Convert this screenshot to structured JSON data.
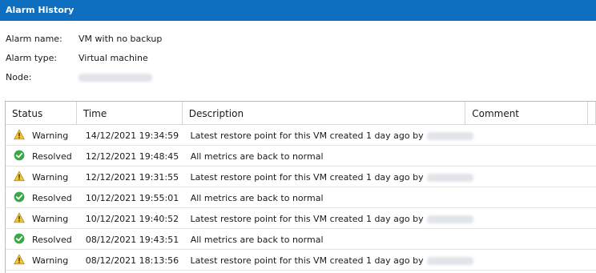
{
  "window": {
    "title": "Alarm History"
  },
  "details": {
    "alarm_name_label": "Alarm name:",
    "alarm_name_value": "VM with no backup",
    "alarm_type_label": "Alarm type:",
    "alarm_type_value": "Virtual machine",
    "node_label": "Node:"
  },
  "table": {
    "columns": [
      "Status",
      "Time",
      "Description",
      "Comment"
    ],
    "rows": [
      {
        "status": "Warning",
        "status_icon": "warning-icon",
        "time": "14/12/2021 19:34:59",
        "description": "Latest restore point for this VM created 1 day ago by",
        "comment": ""
      },
      {
        "status": "Resolved",
        "status_icon": "resolved-icon",
        "time": "12/12/2021 19:48:45",
        "description": "All metrics are back to normal",
        "comment": ""
      },
      {
        "status": "Warning",
        "status_icon": "warning-icon",
        "time": "12/12/2021 19:31:55",
        "description": "Latest restore point for this VM created 1 day ago by",
        "comment": ""
      },
      {
        "status": "Resolved",
        "status_icon": "resolved-icon",
        "time": "10/12/2021 19:55:01",
        "description": "All metrics are back to normal",
        "comment": ""
      },
      {
        "status": "Warning",
        "status_icon": "warning-icon",
        "time": "10/12/2021 19:40:52",
        "description": "Latest restore point for this VM created 1 day ago by",
        "comment": ""
      },
      {
        "status": "Resolved",
        "status_icon": "resolved-icon",
        "time": "08/12/2021 19:43:51",
        "description": "All metrics are back to normal",
        "comment": ""
      },
      {
        "status": "Warning",
        "status_icon": "warning-icon",
        "time": "08/12/2021 18:13:56",
        "description": "Latest restore point for this VM created 1 day ago by",
        "comment": ""
      }
    ]
  },
  "colors": {
    "title_bar": "#0e6fc1",
    "warning_fill": "#f4c431",
    "resolved_fill": "#3aa848"
  }
}
